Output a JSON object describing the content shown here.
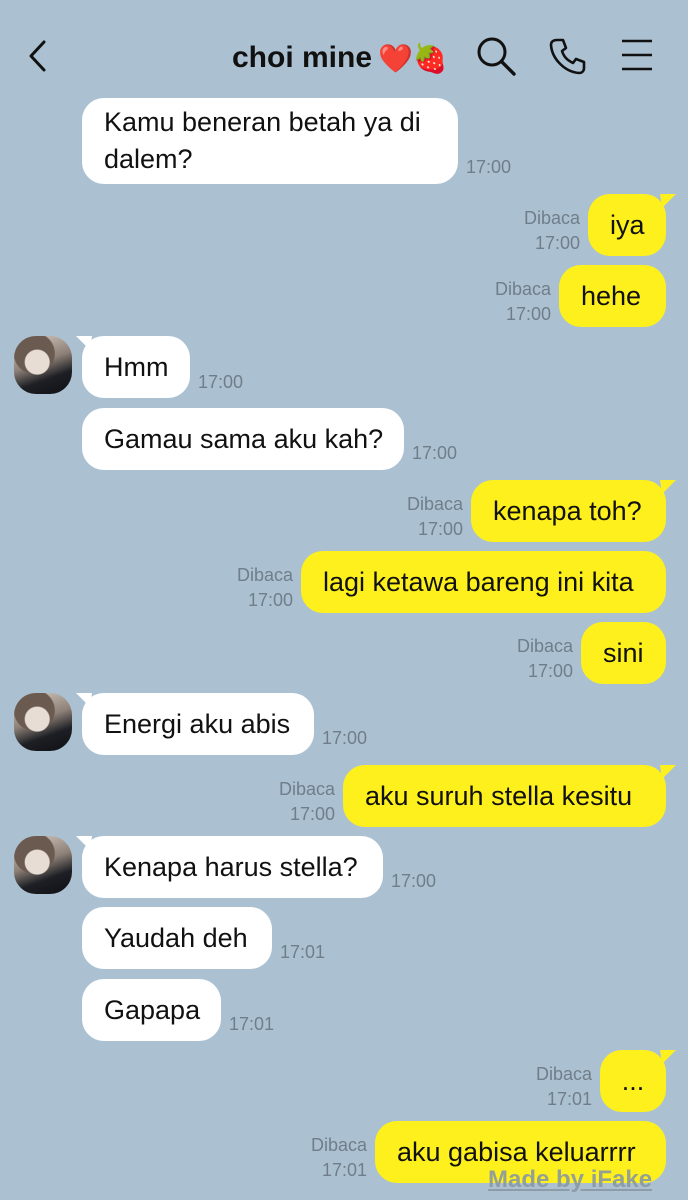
{
  "header": {
    "title": "choi mine",
    "title_emoji": "❤️🍓"
  },
  "messages": [
    {
      "side": "in",
      "text": "Kamu beneran betah ya di dalem?",
      "time": "17:00"
    },
    {
      "side": "out",
      "text": "iya",
      "read": "Dibaca",
      "time": "17:00"
    },
    {
      "side": "out",
      "text": "hehe",
      "read": "Dibaca",
      "time": "17:00"
    },
    {
      "side": "in",
      "text": "Hmm",
      "time": "17:00"
    },
    {
      "side": "in",
      "text": "Gamau sama aku kah?",
      "time": "17:00"
    },
    {
      "side": "out",
      "text": "kenapa toh?",
      "read": "Dibaca",
      "time": "17:00"
    },
    {
      "side": "out",
      "text": "lagi ketawa bareng ini kita",
      "read": "Dibaca",
      "time": "17:00"
    },
    {
      "side": "out",
      "text": "sini",
      "read": "Dibaca",
      "time": "17:00"
    },
    {
      "side": "in",
      "text": "Energi aku abis",
      "time": "17:00"
    },
    {
      "side": "out",
      "text": "aku suruh stella kesitu",
      "read": "Dibaca",
      "time": "17:00"
    },
    {
      "side": "in",
      "text": "Kenapa harus stella?",
      "time": "17:00"
    },
    {
      "side": "in",
      "text": "Yaudah deh",
      "time": "17:01"
    },
    {
      "side": "in",
      "text": "Gapapa",
      "time": "17:01"
    },
    {
      "side": "out",
      "text": "...",
      "read": "Dibaca",
      "time": "17:01"
    },
    {
      "side": "out",
      "text": "aku gabisa keluarrrr",
      "read": "Dibaca",
      "time": "17:01"
    }
  ],
  "watermark": "Made by iFake",
  "colors": {
    "background": "#abc1d1",
    "incoming_bubble": "#ffffff",
    "outgoing_bubble": "#fdf01c",
    "meta_text": "#6f7e8a"
  }
}
